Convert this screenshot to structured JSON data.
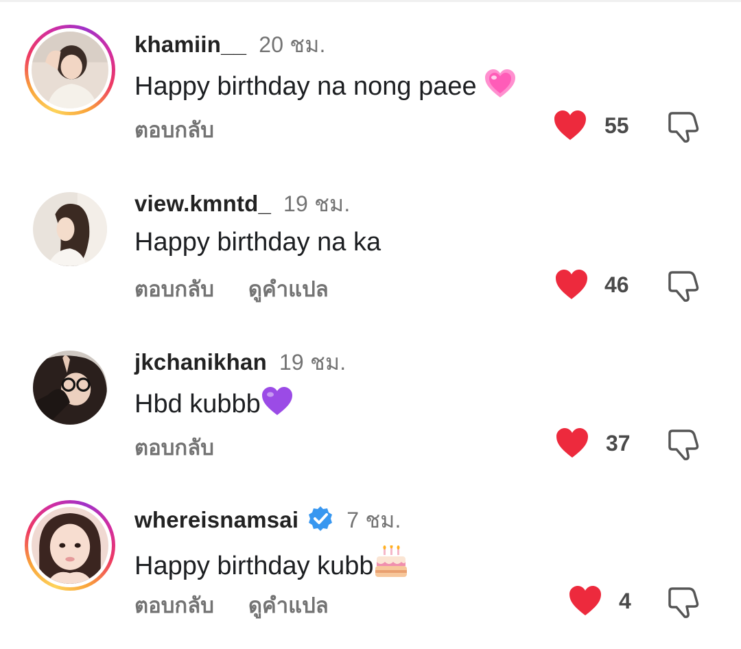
{
  "comments": [
    {
      "username": "khamiin__",
      "time": "20 ชม.",
      "text": "Happy birthday na nong paee",
      "emoji": "pink-heart",
      "reply_label": "ตอบกลับ",
      "translate_label": "",
      "likes": "55",
      "verified": false,
      "story_ring": true
    },
    {
      "username": "view.kmntd_",
      "time": "19 ชม.",
      "text": "Happy birthday na ka",
      "emoji": "",
      "reply_label": "ตอบกลับ",
      "translate_label": "ดูคำแปล",
      "likes": "46",
      "verified": false,
      "story_ring": false
    },
    {
      "username": "jkchanikhan",
      "time": "19 ชม.",
      "text": "Hbd kubbb",
      "emoji": "purple-heart",
      "reply_label": "ตอบกลับ",
      "translate_label": "",
      "likes": "37",
      "verified": false,
      "story_ring": false
    },
    {
      "username": "whereisnamsai",
      "time": "7 ชม.",
      "text": "Happy birthday kubb",
      "emoji": "birthday-cake",
      "reply_label": "ตอบกลับ",
      "translate_label": "ดูคำแปล",
      "likes": "4",
      "verified": true,
      "story_ring": true
    }
  ],
  "colors": {
    "like_red": "#ed2a3d",
    "muted_text": "#737373",
    "verified_blue": "#3897f0"
  }
}
